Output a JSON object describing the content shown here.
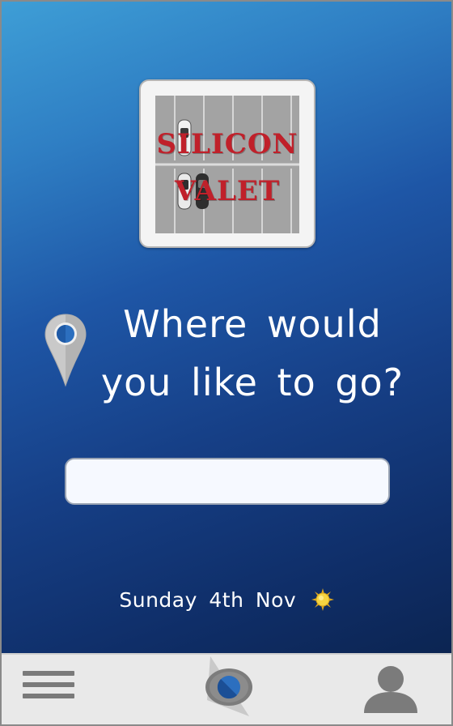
{
  "logo": {
    "line1": "SILICON",
    "line2": "VALET",
    "accent_color": "#c0202a"
  },
  "headline": {
    "line1": "Where would",
    "line2": "you like to go?"
  },
  "search": {
    "value": "",
    "placeholder": ""
  },
  "date": {
    "text": "Sunday 4th Nov",
    "weather_icon": "sun-icon"
  },
  "nav": {
    "menu_icon": "hamburger-menu-icon",
    "center_icon": "compass-icon",
    "profile_icon": "user-profile-icon"
  },
  "colors": {
    "background_top": "#3e9ed6",
    "background_bottom": "#0a1f45",
    "navbar": "#e9e9e9"
  }
}
